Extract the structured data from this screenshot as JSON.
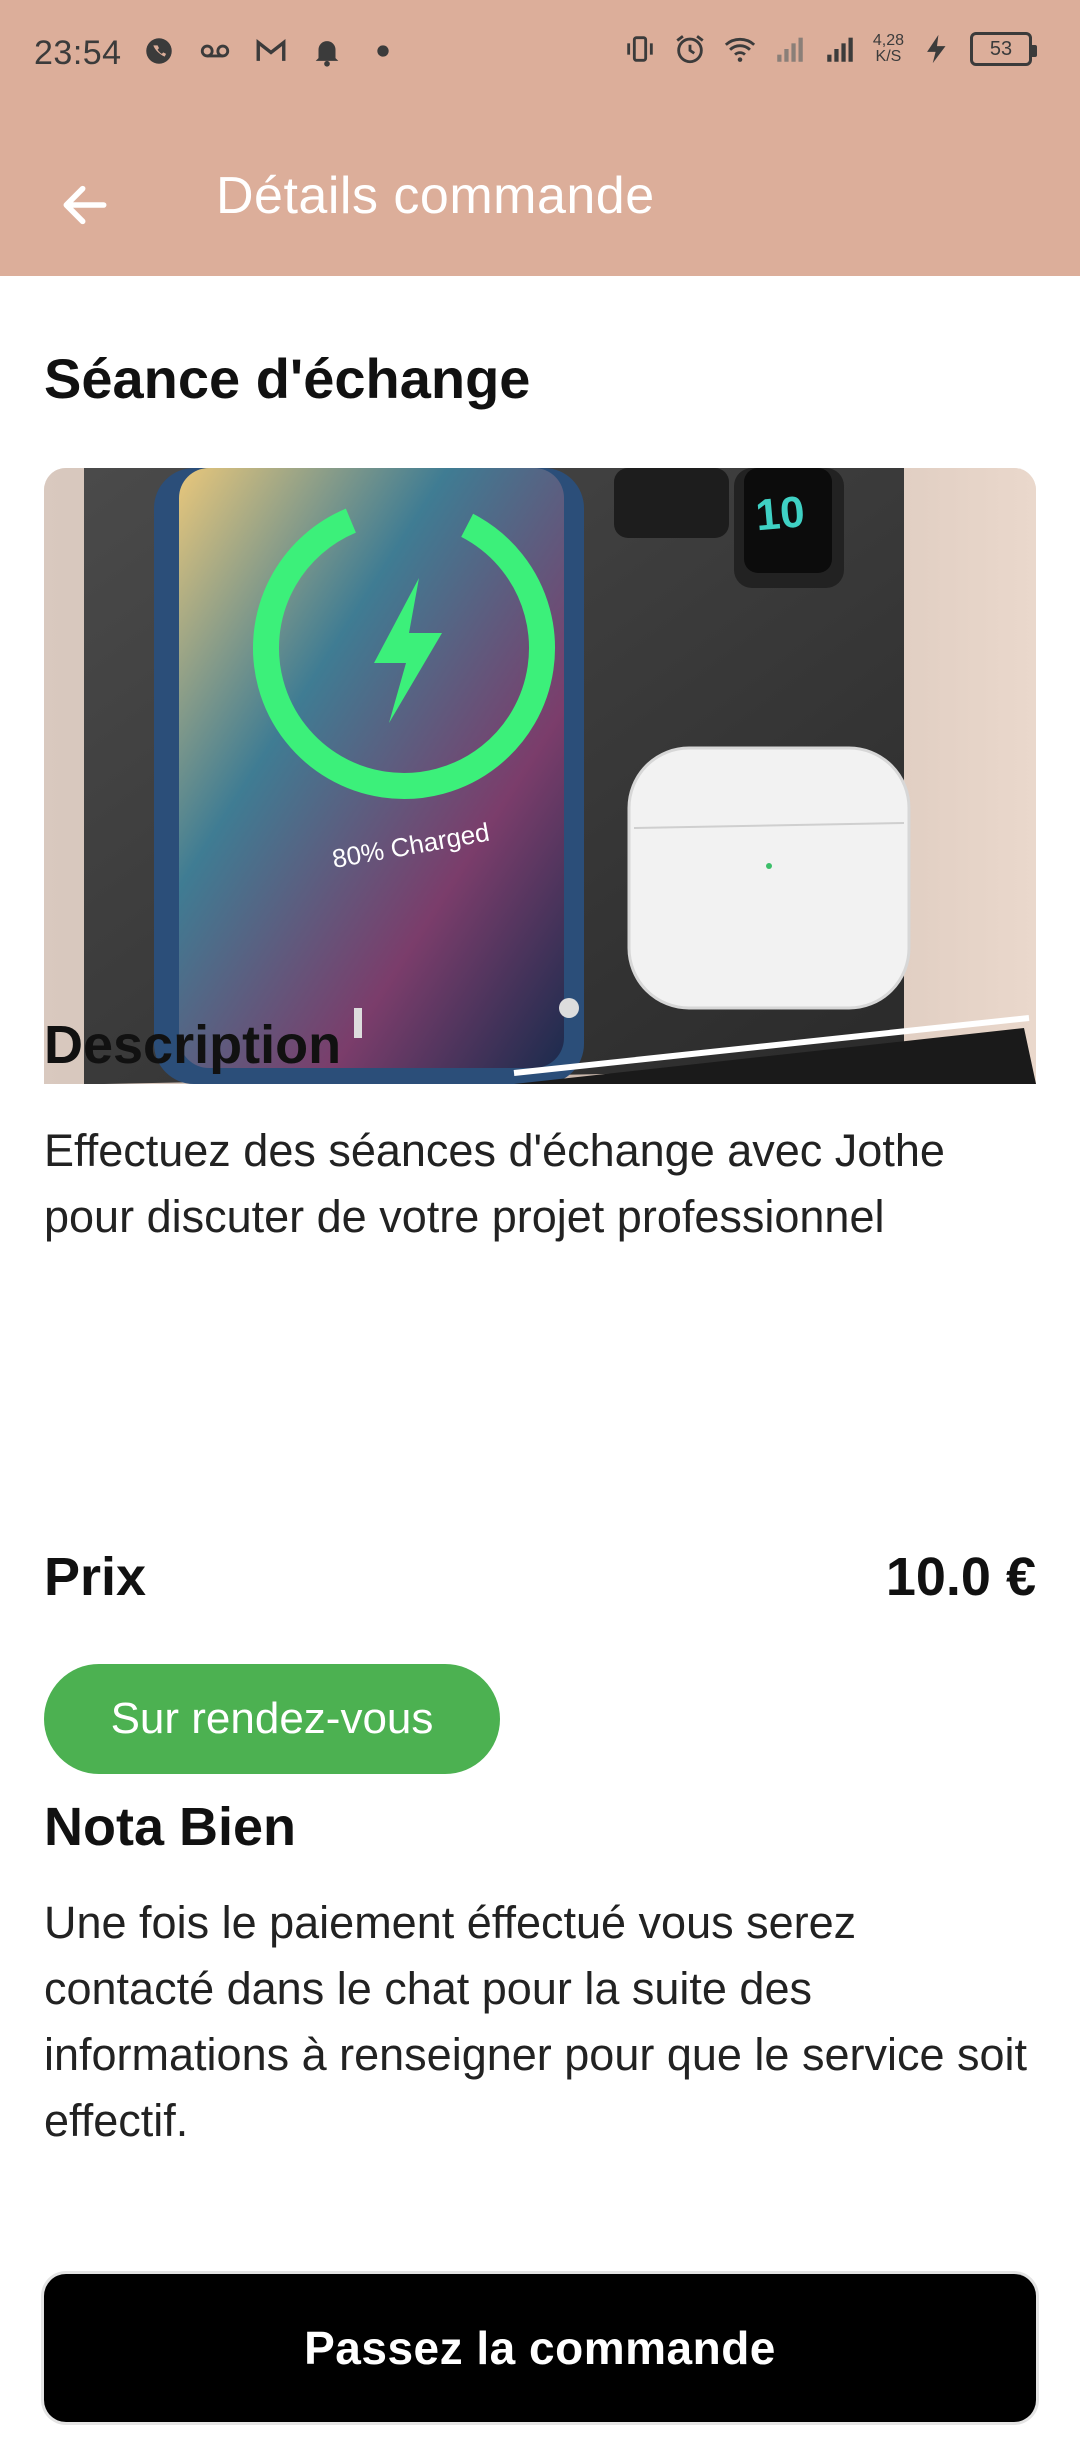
{
  "status_bar": {
    "time": "23:54",
    "net_speed_value": "4,28",
    "net_speed_unit": "K/S",
    "battery": "53",
    "left_icons": [
      "whatsapp-icon",
      "voicemail-icon",
      "gmail-icon",
      "notification-bell-icon",
      "dot-icon"
    ],
    "right_icons": [
      "vibrate-icon",
      "alarm-icon",
      "wifi-icon",
      "signal-icon",
      "signal-icon",
      "charging-icon"
    ]
  },
  "app_bar": {
    "title": "Détails commande",
    "background": "#dcae9a"
  },
  "service": {
    "title": "Séance d'échange",
    "image_text": "80% Charged"
  },
  "description": {
    "heading": "Description",
    "text": "Effectuez des séances d'échange avec Jothe pour discuter de votre projet professionnel"
  },
  "price": {
    "label": "Prix",
    "value": "10.0 €"
  },
  "badge": {
    "label": "Sur rendez-vous",
    "color": "#4cb151"
  },
  "note": {
    "heading": "Nota Bien",
    "text": "Une fois le paiement éffectué vous serez contacté dans le chat pour la suite des informations à renseigner pour que le service soit effectif."
  },
  "cta": {
    "label": "Passez la commande"
  }
}
